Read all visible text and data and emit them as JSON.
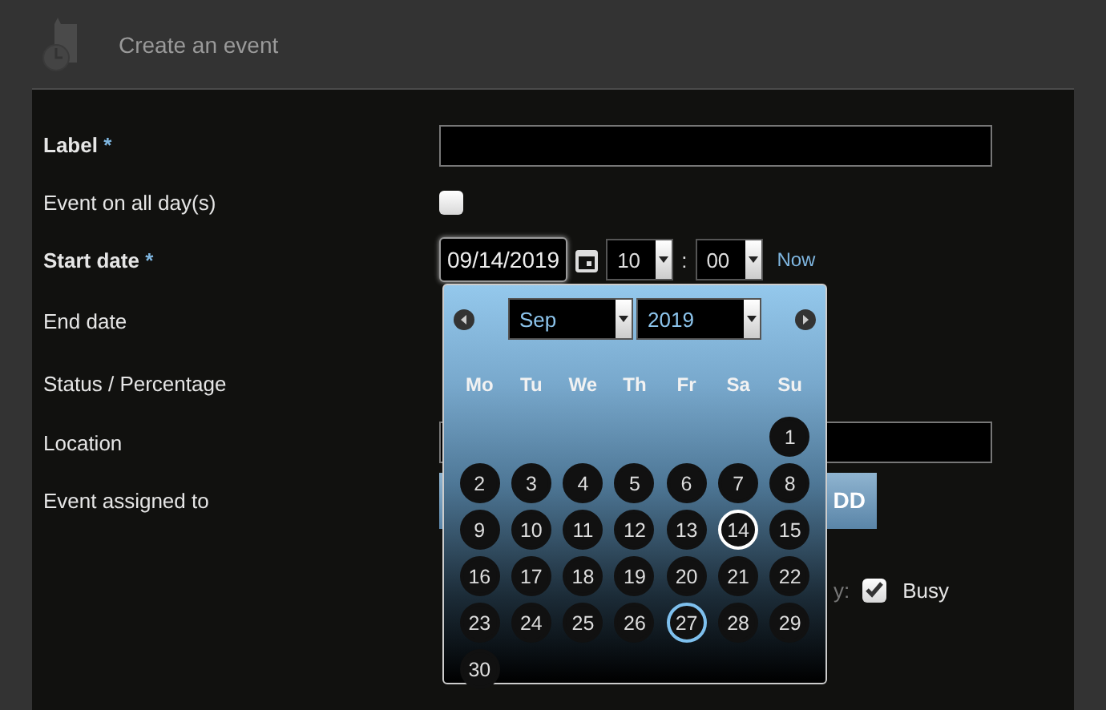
{
  "header": {
    "title": "Create an event"
  },
  "form": {
    "label": {
      "text": "Label",
      "required_mark": "*"
    },
    "all_day": {
      "text": "Event on all day(s)",
      "checked": false
    },
    "start_date": {
      "text": "Start date",
      "required_mark": "*",
      "date": "09/14/2019",
      "hour": "10",
      "separator": ":",
      "minute": "00",
      "now_link": "Now"
    },
    "end_date": {
      "text": "End date"
    },
    "status": {
      "text": "Status / Percentage"
    },
    "location": {
      "text": "Location"
    },
    "assigned": {
      "text": "Event assigned to",
      "button_fragment": "DD"
    },
    "availability": {
      "label_fragment": "y:",
      "checked": true,
      "text": "Busy"
    }
  },
  "datepicker": {
    "month": "Sep",
    "year": "2019",
    "weekdays": [
      "Mo",
      "Tu",
      "We",
      "Th",
      "Fr",
      "Sa",
      "Su"
    ],
    "weeks": [
      [
        {
          "day": "1",
          "selected": false,
          "today": false
        }
      ],
      [
        {
          "day": "2",
          "selected": false,
          "today": false
        },
        {
          "day": "3",
          "selected": false,
          "today": false
        },
        {
          "day": "4",
          "selected": false,
          "today": false
        },
        {
          "day": "5",
          "selected": false,
          "today": false
        },
        {
          "day": "6",
          "selected": false,
          "today": false
        },
        {
          "day": "7",
          "selected": false,
          "today": false
        },
        {
          "day": "8",
          "selected": false,
          "today": false
        }
      ],
      [
        {
          "day": "9",
          "selected": false,
          "today": false
        },
        {
          "day": "10",
          "selected": false,
          "today": false
        },
        {
          "day": "11",
          "selected": false,
          "today": false
        },
        {
          "day": "12",
          "selected": false,
          "today": false
        },
        {
          "day": "13",
          "selected": false,
          "today": false
        },
        {
          "day": "14",
          "selected": true,
          "today": false
        },
        {
          "day": "15",
          "selected": false,
          "today": false
        }
      ],
      [
        {
          "day": "16",
          "selected": false,
          "today": false
        },
        {
          "day": "17",
          "selected": false,
          "today": false
        },
        {
          "day": "18",
          "selected": false,
          "today": false
        },
        {
          "day": "19",
          "selected": false,
          "today": false
        },
        {
          "day": "20",
          "selected": false,
          "today": false
        },
        {
          "day": "21",
          "selected": false,
          "today": false
        },
        {
          "day": "22",
          "selected": false,
          "today": false
        }
      ],
      [
        {
          "day": "23",
          "selected": false,
          "today": false
        },
        {
          "day": "24",
          "selected": false,
          "today": false
        },
        {
          "day": "25",
          "selected": false,
          "today": false
        },
        {
          "day": "26",
          "selected": false,
          "today": false
        },
        {
          "day": "27",
          "selected": false,
          "today": true
        },
        {
          "day": "28",
          "selected": false,
          "today": false
        },
        {
          "day": "29",
          "selected": false,
          "today": false
        }
      ],
      [
        {
          "day": "30",
          "selected": false,
          "today": false
        }
      ]
    ]
  }
}
